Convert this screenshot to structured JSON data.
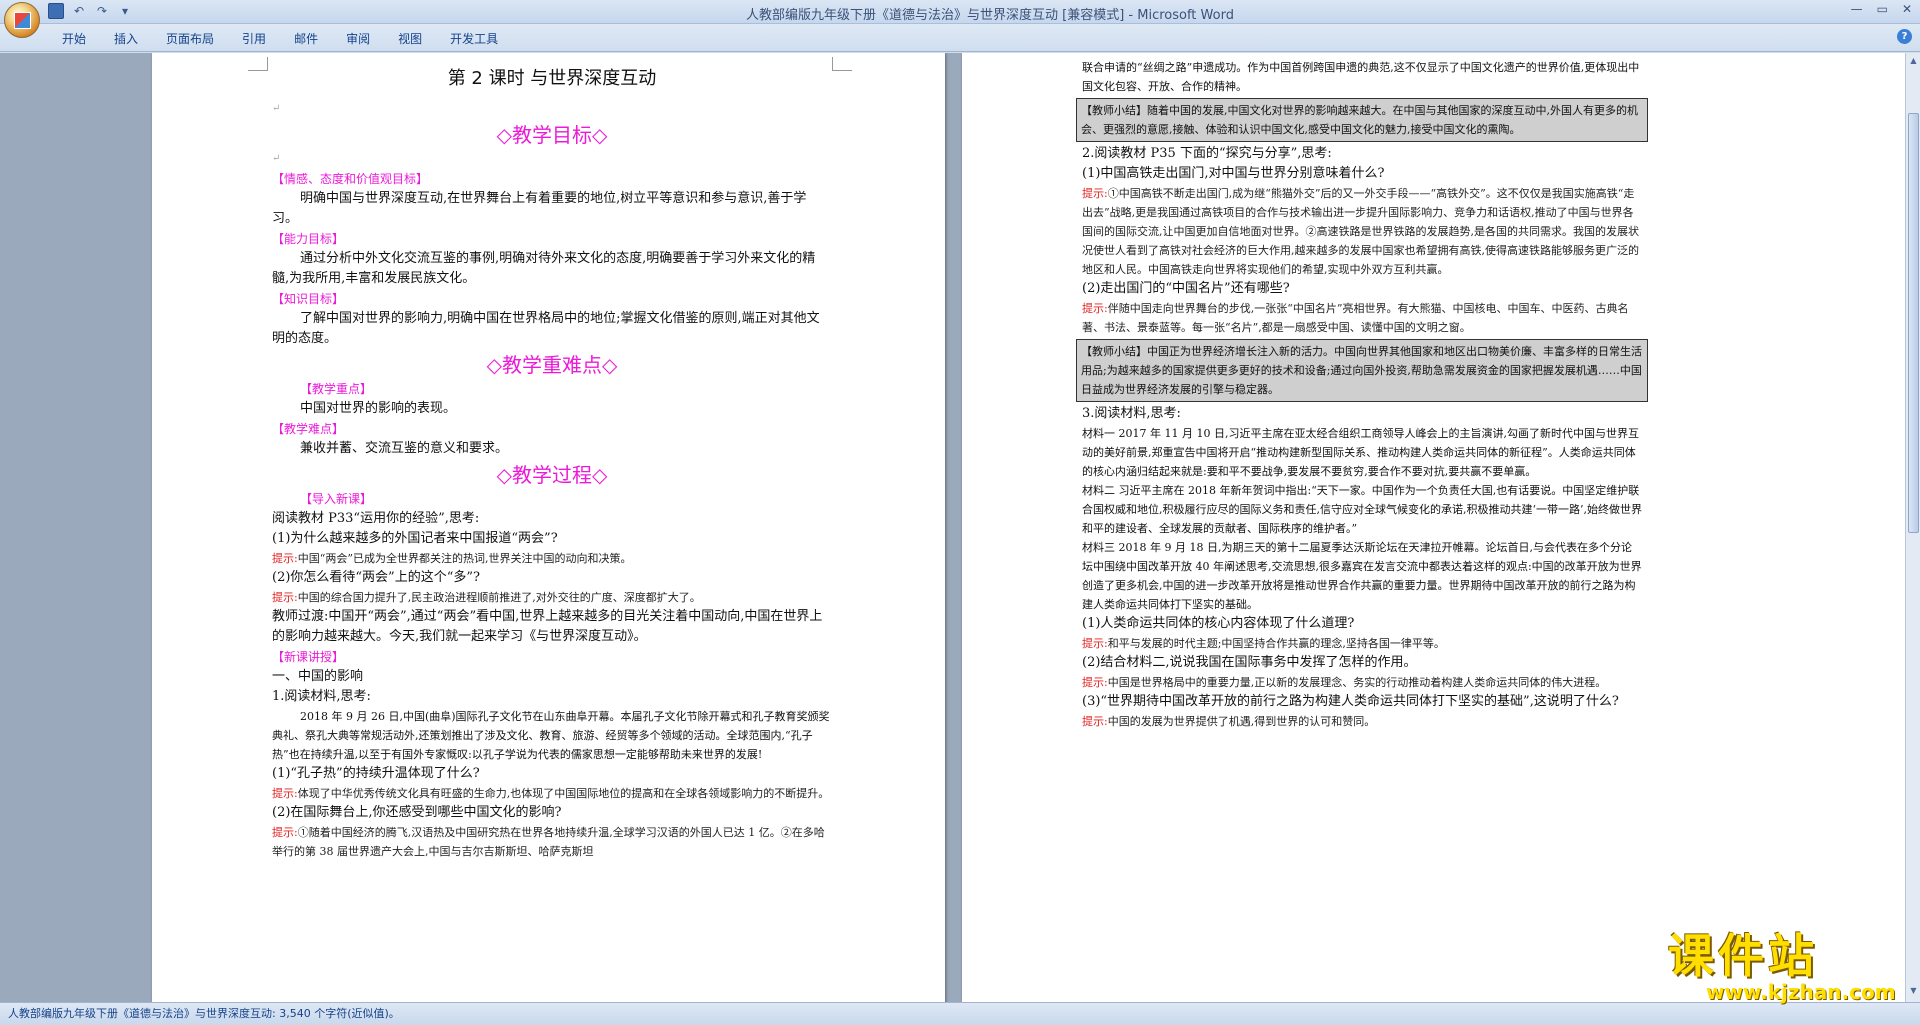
{
  "window": {
    "title": "人教部编版九年级下册《道德与法治》与世界深度互动 [兼容模式] - Microsoft Word",
    "controls": [
      "—",
      "▭",
      "✕"
    ]
  },
  "qat": {
    "icons": [
      "save-icon",
      "undo-icon",
      "redo-icon",
      "customize-icon"
    ]
  },
  "ribbon": {
    "tabs": [
      "开始",
      "插入",
      "页面布局",
      "引用",
      "邮件",
      "审阅",
      "视图",
      "开发工具"
    ]
  },
  "page1": {
    "title": "第 2 课时   与世界深度互动",
    "sec_goal": "◇教学目标◇",
    "goal_emotion_label": "【情感、态度和价值观目标】",
    "goal_emotion_text": "明确中国与世界深度互动,在世界舞台上有着重要的地位,树立平等意识和参与意识,善于学习。",
    "goal_ability_label": "【能力目标】",
    "goal_ability_text": "通过分析中外文化交流互鉴的事例,明确对待外来文化的态度,明确要善于学习外来文化的精髓,为我所用,丰富和发展民族文化。",
    "goal_knowledge_label": "【知识目标】",
    "goal_knowledge_text": "了解中国对世界的影响力,明确中国在世界格局中的地位;掌握文化借鉴的原则,端正对其他文明的态度。",
    "sec_key": "◇教学重难点◇",
    "key_label": "【教学重点】",
    "key_text": "中国对世界的影响的表现。",
    "diff_label": "【教学难点】",
    "diff_text": "兼收并蓄、交流互鉴的意义和要求。",
    "sec_process": "◇教学过程◇",
    "intro_label": "【导入新课】",
    "intro_q": "阅读教材 P33“运用你的经验”,思考:",
    "q1": "(1)为什么越来越多的外国记者来中国报道“两会”?",
    "hint_label": "提示:",
    "a1": "中国“两会”已成为全世界都关注的热词,世界关注中国的动向和决策。",
    "q2": "(2)你怎么看待“两会”上的这个“多”?",
    "a2": "中国的综合国力提升了,民主政治进程顺前推进了,对外交往的广度、深度都扩大了。",
    "transition": "教师过渡:中国开“两会”,通过“两会”看中国,世界上越来越多的目光关注着中国动向,中国在世界上的影响力越来越大。今天,我们就一起来学习《与世界深度互动》。",
    "new_label": "【新课讲授】",
    "part1": "一、中国的影响",
    "read1": "1.阅读材料,思考:",
    "material1": "2018 年 9 月 26 日,中国(曲阜)国际孔子文化节在山东曲阜开幕。本届孔子文化节除开幕式和孔子教育奖颁奖典礼、祭孔大典等常规活动外,还策划推出了涉及文化、教育、旅游、经贸等多个领域的活动。全球范围内,“孔子热”也在持续升温,以至于有国外专家慨叹:以孔子学说为代表的儒家思想一定能够帮助未来世界的发展!",
    "q3": "(1)“孔子热”的持续升温体现了什么?",
    "a3": "体现了中华优秀传统文化具有旺盛的生命力,也体现了中国国际地位的提高和在全球各领域影响力的不断提升。",
    "q4": "(2)在国际舞台上,你还感受到哪些中国文化的影响?",
    "a4": "①随着中国经济的腾飞,汉语热及中国研究热在世界各地持续升温,全球学习汉语的外国人已达 1 亿。②在多哈举行的第 38 届世界遗产大会上,中国与吉尔吉斯斯坦、哈萨克斯坦"
  },
  "page2": {
    "top_text": "联合申请的“丝绸之路”申遗成功。作为中国首例跨国申遗的典范,这不仅显示了中国文化遗产的世界价值,更体现出中国文化包容、开放、合作的精神。",
    "summary1": "【教师小结】随着中国的发展,中国文化对世界的影响越来越大。在中国与其他国家的深度互动中,外国人有更多的机会、更强烈的意愿,接触、体验和认识中国文化,感受中国文化的魅力,接受中国文化的熏陶。",
    "read2": "2.阅读教材 P35 下面的“探究与分享”,思考:",
    "q5": "(1)中国高铁走出国门,对中国与世界分别意味着什么?",
    "hint_label": "提示:",
    "a5": "①中国高铁不断走出国门,成为继“熊猫外交”后的又一外交手段——“高铁外交”。这不仅仅是我国实施高铁“走出去”战略,更是我国通过高铁项目的合作与技术输出进一步提升国际影响力、竞争力和话语权,推动了中国与世界各国间的国际交流,让中国更加自信地面对世界。②高速铁路是世界铁路的发展趋势,是各国的共同需求。我国的发展状况使世人看到了高铁对社会经济的巨大作用,越来越多的发展中国家也希望拥有高铁,使得高速铁路能够服务更广泛的地区和人民。中国高铁走向世界将实现他们的希望,实现中外双方互利共赢。",
    "q6": "(2)走出国门的“中国名片”还有哪些?",
    "a6": "伴随中国走向世界舞台的步伐,一张张“中国名片”亮相世界。有大熊猫、中国核电、中国车、中医药、古典名著、书法、景泰蓝等。每一张“名片”,都是一扇感受中国、读懂中国的文明之窗。",
    "summary2": "【教师小结】中国正为世界经济增长注入新的活力。中国向世界其他国家和地区出口物美价廉、丰富多样的日常生活用品;为越来越多的国家提供更多更好的技术和设备;通过向国外投资,帮助急需发展资金的国家把握发展机遇……中国日益成为世界经济发展的引擎与稳定器。",
    "read3": "3.阅读材料,思考:",
    "m1": "材料一   2017 年 11 月 10 日,习近平主席在亚太经合组织工商领导人峰会上的主旨演讲,勾画了新时代中国与世界互动的美好前景,郑重宣告中国将开启“推动构建新型国际关系、推动构建人类命运共同体的新征程”。人类命运共同体的核心内涵归结起来就是:要和平不要战争,要发展不要贫穷,要合作不要对抗,要共赢不要单赢。",
    "m2": "材料二   习近平主席在 2018 年新年贺词中指出:“天下一家。中国作为一个负责任大国,也有话要说。中国坚定维护联合国权威和地位,积极履行应尽的国际义务和责任,信守应对全球气候变化的承诺,积极推动共建‘一带一路’,始终做世界和平的建设者、全球发展的贡献者、国际秩序的维护者。”",
    "m3": "材料三   2018 年 9 月 18 日,为期三天的第十二届夏季达沃斯论坛在天津拉开帷幕。论坛首日,与会代表在多个分论坛中围绕中国改革开放 40 年阐述思考,交流思想,很多嘉宾在发言交流中都表达着这样的观点:中国的改革开放为世界创造了更多机会,中国的进一步改革开放将是推动世界合作共赢的重要力量。世界期待中国改革开放的前行之路为构建人类命运共同体打下坚实的基础。",
    "q7": "(1)人类命运共同体的核心内容体现了什么道理?",
    "a7": "和平与发展的时代主题;中国坚持合作共赢的理念,坚持各国一律平等。",
    "q8": "(2)结合材料二,说说我国在国际事务中发挥了怎样的作用。",
    "a8": "中国是世界格局中的重要力量,正以新的发展理念、务实的行动推动着构建人类命运共同体的伟大进程。",
    "q9": "(3)“世界期待中国改革开放的前行之路为构建人类命运共同体打下坚实的基础”,这说明了什么?",
    "a9": "中国的发展为世界提供了机遇,得到世界的认可和赞同。"
  },
  "status": {
    "text": "人教部编版九年级下册《道德与法治》与世界深度互动: 3,540 个字符(近似值)。"
  },
  "watermark": {
    "cn": "课件站",
    "url": "www.kjzhan.com"
  }
}
